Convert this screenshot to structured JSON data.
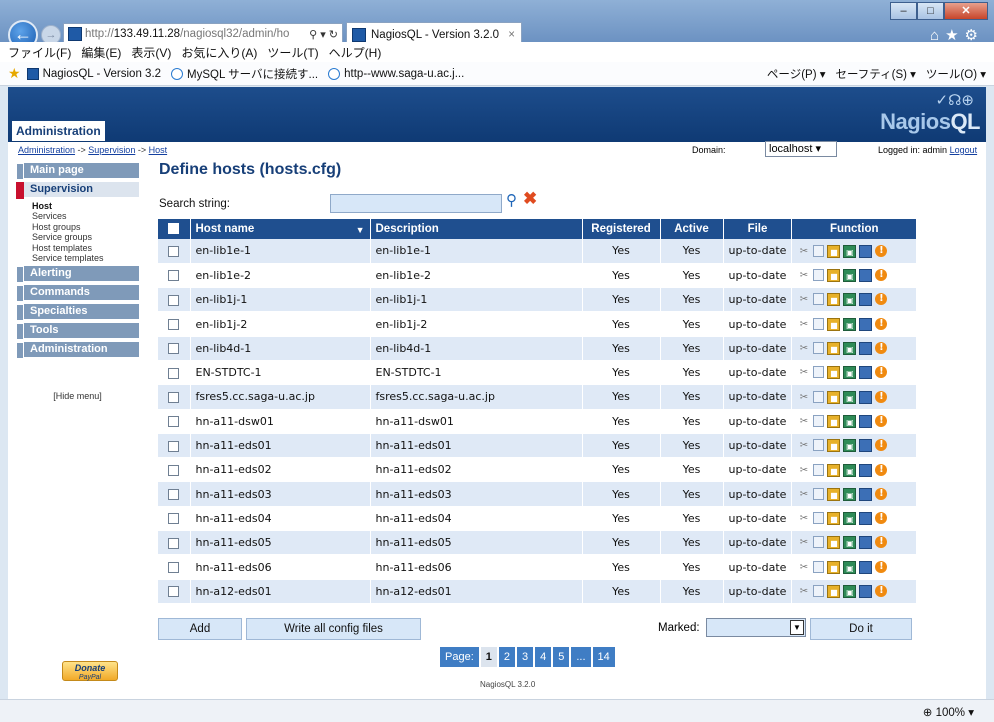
{
  "browser": {
    "url_prefix": "http://",
    "url_host": "133.49.11.28",
    "url_rest": "/nagiosql32/admin/ho",
    "url_tools": "⚲ ▾ ↻",
    "tab_title": "NagiosQL - Version 3.2.0",
    "tab_close": "×",
    "menu": [
      "ファイル(F)",
      "編集(E)",
      "表示(V)",
      "お気に入り(A)",
      "ツール(T)",
      "ヘルプ(H)"
    ],
    "favorites": [
      "NagiosQL - Version 3.2",
      "MySQL サーバに接続す...",
      "http--www.saga-u.ac.j..."
    ],
    "fav_tools": [
      "ページ(P) ▾",
      "セーフティ(S) ▾",
      "ツール(O) ▾"
    ],
    "zoom": "100%"
  },
  "header": {
    "admin_tab": "Administration",
    "logo_main": "Nagios",
    "logo_ql": "QL"
  },
  "breadcrumb": {
    "a": "Administration",
    "b": "Supervision",
    "c": "Host",
    "sep": " -> "
  },
  "domain": {
    "label": "Domain:",
    "value": "localhost",
    "logged_label": "Logged in: admin",
    "logout": "Logout"
  },
  "sidebar": {
    "main_page": "Main page",
    "supervision": "Supervision",
    "sub": [
      "Host",
      "Services",
      "Host groups",
      "Service groups",
      "Host templates",
      "Service templates"
    ],
    "alerting": "Alerting",
    "commands": "Commands",
    "specialties": "Specialties",
    "tools": "Tools",
    "administration": "Administration",
    "hide_menu": "[Hide menu]",
    "donate": "Donate",
    "paypal": "PayPal"
  },
  "page": {
    "title": "Define hosts (hosts.cfg)",
    "search_label": "Search string:"
  },
  "table": {
    "headers": [
      "Host name",
      "Description",
      "Registered",
      "Active",
      "File",
      "Function"
    ],
    "rows": [
      {
        "name": "en-lib1e-1",
        "desc": "en-lib1e-1",
        "registered": "Yes",
        "active": "Yes",
        "file": "up-to-date"
      },
      {
        "name": "en-lib1e-2",
        "desc": "en-lib1e-2",
        "registered": "Yes",
        "active": "Yes",
        "file": "up-to-date"
      },
      {
        "name": "en-lib1j-1",
        "desc": "en-lib1j-1",
        "registered": "Yes",
        "active": "Yes",
        "file": "up-to-date"
      },
      {
        "name": "en-lib1j-2",
        "desc": "en-lib1j-2",
        "registered": "Yes",
        "active": "Yes",
        "file": "up-to-date"
      },
      {
        "name": "en-lib4d-1",
        "desc": "en-lib4d-1",
        "registered": "Yes",
        "active": "Yes",
        "file": "up-to-date"
      },
      {
        "name": "EN-STDTC-1",
        "desc": "EN-STDTC-1",
        "registered": "Yes",
        "active": "Yes",
        "file": "up-to-date"
      },
      {
        "name": "fsres5.cc.saga-u.ac.jp",
        "desc": "fsres5.cc.saga-u.ac.jp",
        "registered": "Yes",
        "active": "Yes",
        "file": "up-to-date"
      },
      {
        "name": "hn-a11-dsw01",
        "desc": "hn-a11-dsw01",
        "registered": "Yes",
        "active": "Yes",
        "file": "up-to-date"
      },
      {
        "name": "hn-a11-eds01",
        "desc": "hn-a11-eds01",
        "registered": "Yes",
        "active": "Yes",
        "file": "up-to-date"
      },
      {
        "name": "hn-a11-eds02",
        "desc": "hn-a11-eds02",
        "registered": "Yes",
        "active": "Yes",
        "file": "up-to-date"
      },
      {
        "name": "hn-a11-eds03",
        "desc": "hn-a11-eds03",
        "registered": "Yes",
        "active": "Yes",
        "file": "up-to-date"
      },
      {
        "name": "hn-a11-eds04",
        "desc": "hn-a11-eds04",
        "registered": "Yes",
        "active": "Yes",
        "file": "up-to-date"
      },
      {
        "name": "hn-a11-eds05",
        "desc": "hn-a11-eds05",
        "registered": "Yes",
        "active": "Yes",
        "file": "up-to-date"
      },
      {
        "name": "hn-a11-eds06",
        "desc": "hn-a11-eds06",
        "registered": "Yes",
        "active": "Yes",
        "file": "up-to-date"
      },
      {
        "name": "hn-a12-eds01",
        "desc": "hn-a12-eds01",
        "registered": "Yes",
        "active": "Yes",
        "file": "up-to-date"
      }
    ]
  },
  "actions": {
    "add": "Add",
    "write_all": "Write all config files",
    "marked_label": "Marked:",
    "marked_value": "",
    "do_it": "Do it"
  },
  "pagination": {
    "label": "Page:",
    "pages": [
      "1",
      "2",
      "3",
      "4",
      "5",
      "...",
      "14"
    ],
    "current": "1"
  },
  "footer": "NagiosQL 3.2.0"
}
